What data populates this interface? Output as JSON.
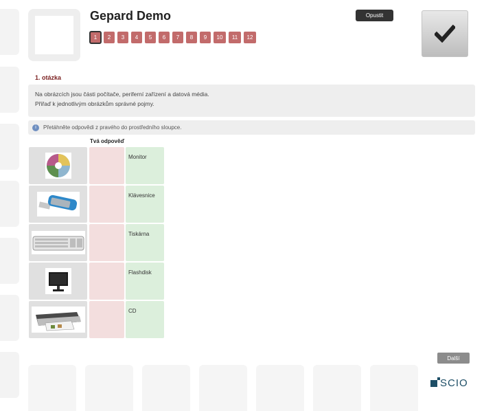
{
  "header": {
    "title": "Gepard Demo",
    "quit_label": "Opustit",
    "questions": [
      "1",
      "2",
      "3",
      "4",
      "5",
      "6",
      "7",
      "8",
      "9",
      "10",
      "11",
      "12"
    ],
    "active_question": "1"
  },
  "question": {
    "heading": "1. otázka",
    "text_line1": "Na obrázcích jsou části počítače, periferní zařízení a datová média.",
    "text_line2": "Přiřaď k jednotlivým obrázkům správné pojmy.",
    "hint": "Přetáhněte odpovědi z pravého do prostředního sloupce.",
    "answer_column_header": "Tvá odpověď"
  },
  "rows": [
    {
      "image": "cd-disc-image",
      "answer": "Monitor"
    },
    {
      "image": "flashdisk-image",
      "answer": "Klávesnice"
    },
    {
      "image": "keyboard-image",
      "answer": "Tiskárna"
    },
    {
      "image": "monitor-image",
      "answer": "Flashdisk"
    },
    {
      "image": "printer-image",
      "answer": "CD"
    }
  ],
  "footer": {
    "next_label": "Další",
    "brand": "SCIO"
  },
  "colors": {
    "question_button": "#c26b6b",
    "drop_zone": "#f3dede",
    "answer_tile": "#dcefdc",
    "heading": "#7a1f1f",
    "brand": "#1d4e66"
  }
}
